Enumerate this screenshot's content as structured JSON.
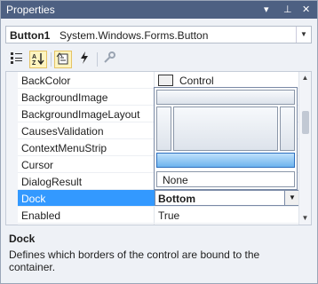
{
  "window": {
    "title": "Properties",
    "pin_glyph": "▾",
    "autohide_glyph": "⊥",
    "close_glyph": "✕"
  },
  "object_selector": {
    "name": "Button1",
    "type": "System.Windows.Forms.Button"
  },
  "toolbar": {
    "categorized_icon": "categorized-icon",
    "alphabetical_icon": "alphabetical-icon",
    "properties_icon": "properties-icon",
    "events_icon": "events-icon",
    "property_pages_icon": "property-pages-icon"
  },
  "properties": [
    {
      "name": "BackColor",
      "value": "Control",
      "color_swatch": "#f0f0f0"
    },
    {
      "name": "BackgroundImage",
      "value": ""
    },
    {
      "name": "BackgroundImageLayout",
      "value": ""
    },
    {
      "name": "CausesValidation",
      "value": ""
    },
    {
      "name": "ContextMenuStrip",
      "value": ""
    },
    {
      "name": "Cursor",
      "value": ""
    },
    {
      "name": "DialogResult",
      "value": ""
    },
    {
      "name": "Dock",
      "value": "Bottom",
      "selected": true
    },
    {
      "name": "Enabled",
      "value": "True"
    }
  ],
  "dock_editor": {
    "selected": "Bottom",
    "none_label": "None"
  },
  "description": {
    "title": "Dock",
    "text": "Defines which borders of the control are bound to the container."
  }
}
